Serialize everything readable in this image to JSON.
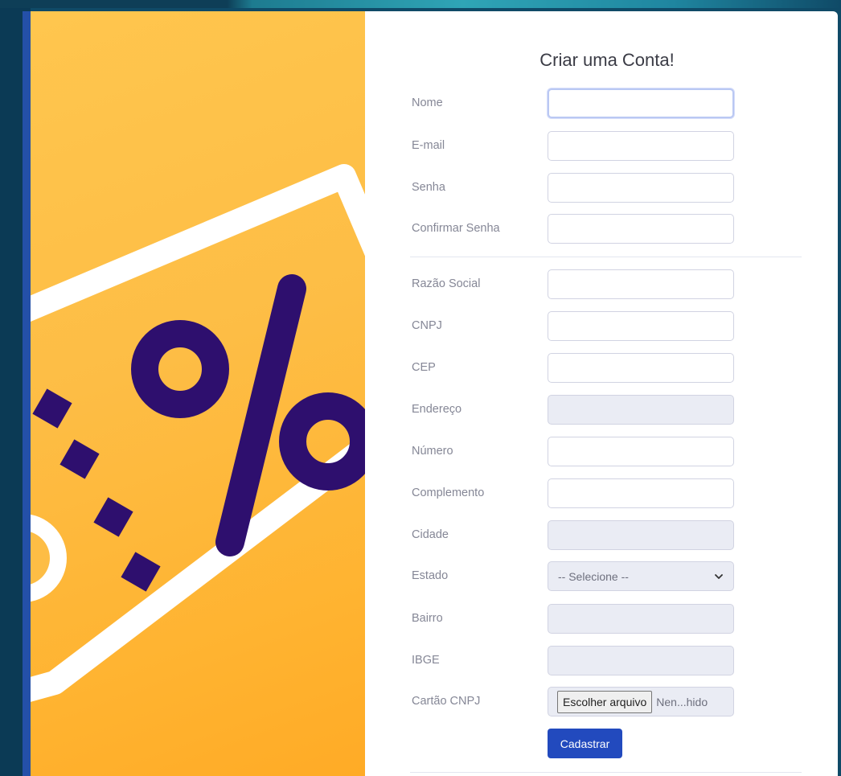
{
  "form": {
    "title": "Criar uma Conta!",
    "fields": {
      "nome": {
        "label": "Nome",
        "value": ""
      },
      "email": {
        "label": "E-mail",
        "value": ""
      },
      "senha": {
        "label": "Senha",
        "value": ""
      },
      "confirmar_senha": {
        "label": "Confirmar Senha",
        "value": ""
      },
      "razao_social": {
        "label": "Razão Social",
        "value": ""
      },
      "cnpj": {
        "label": "CNPJ",
        "value": ""
      },
      "cep": {
        "label": "CEP",
        "value": ""
      },
      "endereco": {
        "label": "Endereço",
        "value": ""
      },
      "numero": {
        "label": "Número",
        "value": ""
      },
      "complemento": {
        "label": "Complemento",
        "value": ""
      },
      "cidade": {
        "label": "Cidade",
        "value": ""
      },
      "estado": {
        "label": "Estado",
        "selected": "-- Selecione --"
      },
      "bairro": {
        "label": "Bairro",
        "value": ""
      },
      "ibge": {
        "label": "IBGE",
        "value": ""
      },
      "cartao_cnpj": {
        "label": "Cartão CNPJ",
        "button_label": "Escolher arquivo",
        "status": "Nen...hido"
      }
    },
    "submit_label": "Cadastrar"
  },
  "colors": {
    "primary": "#224abe",
    "illustration_bg": "#fdbd45",
    "tag_symbol": "#2e0f6e",
    "page_bg": "#0f4a67"
  },
  "illustration": {
    "icon": "discount-tag-icon"
  }
}
